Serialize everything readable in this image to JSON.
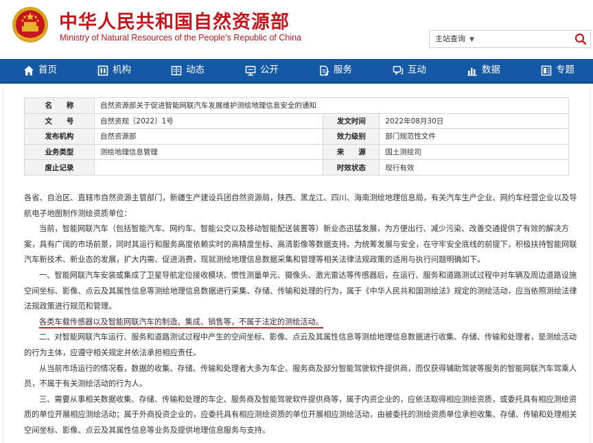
{
  "header": {
    "title_cn": "中华人民共和国自然资源部",
    "title_en": "Ministry of Natural Resources of the People’s Republic of China",
    "search_scope": "主站查询",
    "search_placeholder": ""
  },
  "nav": {
    "items": [
      {
        "label": "首页",
        "icon": "home-icon"
      },
      {
        "label": "机构",
        "icon": "organization-icon"
      },
      {
        "label": "动态",
        "icon": "news-icon"
      },
      {
        "label": "公开",
        "icon": "disclosure-icon"
      },
      {
        "label": "服务",
        "icon": "service-icon"
      },
      {
        "label": "互动",
        "icon": "chat-icon"
      },
      {
        "label": "数据",
        "icon": "chart-icon"
      },
      {
        "label": "专题",
        "icon": "topic-icon"
      }
    ]
  },
  "meta": {
    "name_label": "名　　称",
    "name_value": "自然资源部关于促进智能网联汽车发展维护测绘地理信息安全的通知",
    "doc_no_label": "文　　号",
    "doc_no_value": "自然资规〔2022〕1号",
    "issue_date_label": "发文时间",
    "issue_date_value": "2022年08月30日",
    "issuer_label": "发布机构",
    "issuer_value": "自然资源部",
    "validity_level_label": "效力级别",
    "validity_level_value": "部门规范性文件",
    "business_type_label": "业务类型",
    "business_type_value": "测绘地理信息管理",
    "source_label": "来　　源",
    "source_value": "国土测绘司",
    "repeal_label": "废止记录",
    "repeal_value": "",
    "status_label": "时效状态",
    "status_value": "现行有效"
  },
  "article": {
    "p1": "各省、自治区、直辖市自然资源主管部门，新疆生产建设兵团自然资源局，陕西、黑龙江、四川、海南测绘地理信息局，有关汽车生产企业、网约车经营企业以及导航电子地图制作测绘资质单位：",
    "p2": "当前，智能网联汽车（包括智能汽车、网约车、智能公交以及移动智能配送装置等）新业态迅猛发展，为方便出行、减少污染、改善交通提供了有效的解决方案，具有广阔的市场前景，同时其运行和服务高度依赖实时的高精度坐标、高清影像等数据支持。为统筹发展与安全，在守牢安全底线的前提下，积极扶持智能网联汽车新技术、新业态的发展，扩大内需、促进消费，现就测绘地理信息数据采集和管理等相关法律法规政策的适用与执行问题明确如下。",
    "p3": "一、智能网联汽车安装或集成了卫星导航定位接收模块、惯性测量单元、摄像头、激光雷达等传感器后，在运行、服务和道路测试过程中对车辆及周边道路设施空间坐标、影像、点云及其属性信息等测绘地理信息数据进行采集、存储、传输和处理的行为，属于《中华人民共和国测绘法》规定的测绘活动，应当依照测绘法律法规政策进行规范和管理。",
    "p4": "各类车载传感器以及智能网联汽车的制造、集成、销售等，不属于法定的测绘活动。",
    "p5": "二、对智能网联汽车运行、服务和道路测试过程中产生的空间坐标、影像、点云及其属性信息等测绘地理信息数据进行收集、存储、传输和处理者，是测绘活动的行为主体，应遵守相关规定并依法承担相应责任。",
    "p6": "从当前市场运行的情况看，数据的收集、存储、传输和处理者大多为车企、服务商及部分智能驾驶软件提供商，而仅获得辅助驾驶等服务的智能网联汽车驾乘人员，不属于有关测绘活动的行为人。",
    "p7": "三、需要从事相关数据收集、存储、传输和处理的车企、服务商及智能驾驶软件提供商等，属于内资企业的，应依法取得相应测绘资质，或委托具有相应测绘资质的单位开展相应测绘活动；属于外商投资企业的，应委托具有相应测绘资质的单位开展相应测绘活动，由被委托的测绘资质单位承担收集、存储、传输和处理相关空间坐标、影像、点云及其属性信息等业务及提供地理信息服务与支持。"
  },
  "colors": {
    "brand_red": "#c5161d",
    "nav_blue": "#1559a6",
    "underline_red": "#d21f1f"
  }
}
